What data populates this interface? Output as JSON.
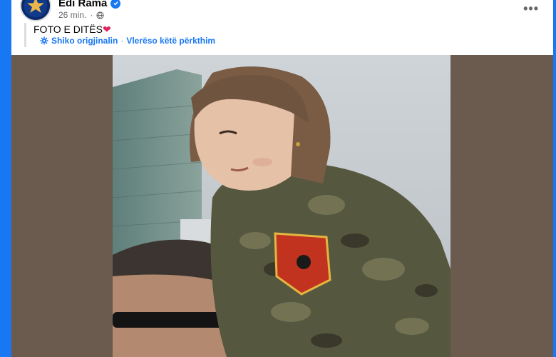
{
  "post": {
    "author": "Edi Rama",
    "time": "26 min.",
    "text": "FOTO E DITËS",
    "heart": "❤",
    "see_original": "Shiko origjinalin",
    "separator": "·",
    "rate_translation": "Vlerëso këtë përkthim"
  },
  "icons": {
    "verified": "verified-badge-icon",
    "privacy": "globe-icon",
    "translate": "gear-icon",
    "more": "more-options-icon"
  },
  "colors": {
    "accent": "#1877f2",
    "photo_bg": "#6b5b4e",
    "text_secondary": "#65676b"
  }
}
